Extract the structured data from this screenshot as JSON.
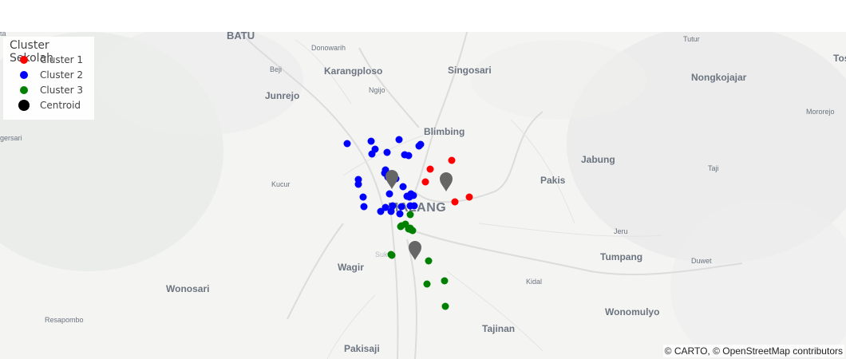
{
  "legend": {
    "title": "Cluster Sekolah",
    "items": [
      {
        "label": "Cluster 1",
        "color": "#ff0000"
      },
      {
        "label": "Cluster 2",
        "color": "#0000ff"
      },
      {
        "label": "Cluster 3",
        "color": "#008000"
      },
      {
        "label": "Centroid",
        "color": "#000000"
      }
    ]
  },
  "attribution": "© CARTO, © OpenStreetMap contributors",
  "basemap_labels": [
    "BATU",
    "Donowarih",
    "Tutur",
    "Tos",
    "Beji",
    "Karangploso",
    "Singosari",
    "Nongkojajar",
    "Ngijo",
    "Junrejo",
    "Mororejo",
    "gersari",
    "Blimbing",
    "Jabung",
    "Taji",
    "Kucur",
    "Pakis",
    "MALANG",
    "Jeru",
    "Sukun",
    "Tumpang",
    "Duwet",
    "Wagir",
    "Kidal",
    "Wonosari",
    "Wonomulyo",
    "Resapombo",
    "Tajinan",
    "Pakisaji",
    "ta"
  ],
  "markers": {
    "cluster_1": {
      "color": "#ff0000",
      "count": 6
    },
    "cluster_2": {
      "color": "#0000ff",
      "count": 33
    },
    "cluster_3": {
      "color": "#008000",
      "count": 14
    },
    "centroid": {
      "color": "#666666",
      "icon": "map-pin-icon",
      "count": 3
    }
  }
}
